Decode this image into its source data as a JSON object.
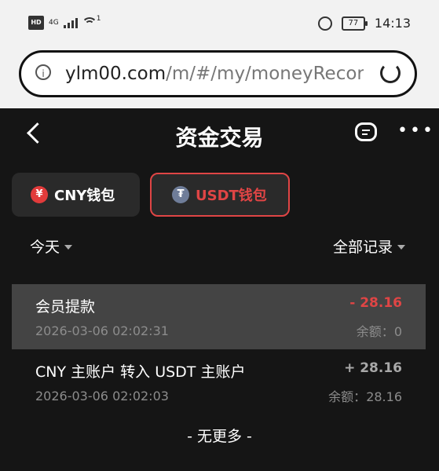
{
  "status": {
    "network": "4G",
    "hd": "HD",
    "hotspot_badge": "1",
    "battery": "77",
    "time": "14:13"
  },
  "browser": {
    "url_host": "ylm00.com",
    "url_rest": "/m/#/my/moneyRecorc"
  },
  "nav": {
    "title": "资金交易"
  },
  "wallets": [
    {
      "label": "CNY钱包",
      "symbol": "¥",
      "active": false
    },
    {
      "label": "USDT钱包",
      "symbol": "₮",
      "active": true
    }
  ],
  "filters": {
    "date": "今天",
    "type": "全部记录"
  },
  "records": [
    {
      "title": "会员提款",
      "time": "2026-03-06 02:02:31",
      "amount": "- 28.16",
      "balance_label": "余额：",
      "balance": "0"
    },
    {
      "title": "CNY 主账户 转入 USDT 主账户",
      "time": "2026-03-06 02:02:03",
      "amount": "+ 28.16",
      "balance_label": "余额：",
      "balance": "28.16"
    }
  ],
  "footer": {
    "no_more": "- 无更多 -"
  },
  "colors": {
    "accent": "#e04545",
    "background": "#151515",
    "highlight_row": "#444444"
  }
}
